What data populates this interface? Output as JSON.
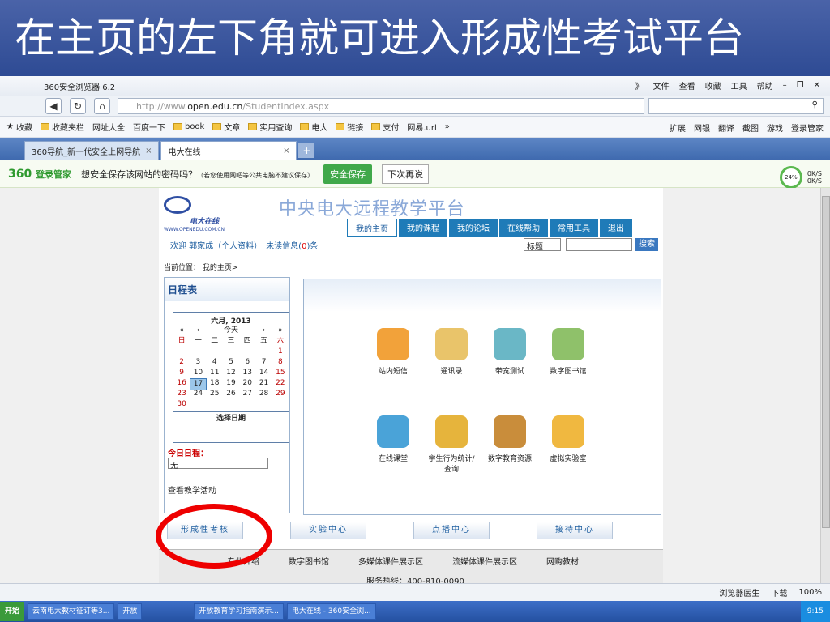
{
  "slide": {
    "title": "在主页的左下角就可进入形成性考试平台"
  },
  "browser": {
    "name": "360安全浏览器 6.2",
    "menu": [
      "》",
      "文件",
      "查看",
      "收藏",
      "工具",
      "帮助"
    ],
    "url_prefix": "http://www.",
    "url_host": "open.edu.cn",
    "url_path": "/StudentIndex.aspx"
  },
  "bookmarks": {
    "items": [
      "收藏",
      "收藏夹栏",
      "网址大全",
      "百度一下",
      "book",
      "文章",
      "实用查询",
      "电大",
      "链接",
      "支付",
      "网易.url",
      "»"
    ],
    "right": [
      "扩展",
      "网银",
      "翻译",
      "截图",
      "游戏",
      "登录管家"
    ]
  },
  "tabs": [
    {
      "label": "360导航_新一代安全上网导航"
    },
    {
      "label": "电大在线"
    }
  ],
  "passbar": {
    "brand": "360",
    "brand2": "登录管家",
    "question": "想安全保存该网站的密码吗？",
    "note": "（若您使用网吧等公共电脑不建议保存）",
    "save": "安全保存",
    "later": "下次再说",
    "pct": "24%",
    "up": "0K/S",
    "down": "0K/S"
  },
  "site": {
    "logo": "电大在线",
    "logo_url": "WWW.OPENEDU.COM.CN",
    "title": "中央电大远程教学平台",
    "nav": [
      "我的主页",
      "我的课程",
      "我的论坛",
      "在线帮助",
      "常用工具",
      "退出"
    ],
    "welcome_pre": "欢迎 郭家成（个人资料）",
    "welcome_unread": "未读信息(",
    "welcome_count": "0",
    "welcome_post": ")条",
    "search_select": "标题",
    "search_btn": "搜索",
    "crumb": "当前位置： 我的主页>",
    "schedule": "日程表",
    "cal": {
      "month": "六月, 2013",
      "nav": [
        "«",
        "‹",
        "今天",
        "›",
        "»"
      ],
      "weekdays": [
        "日",
        "一",
        "二",
        "三",
        "四",
        "五",
        "六"
      ],
      "rows": [
        [
          "",
          "",
          "",
          "",
          "",
          "",
          "1"
        ],
        [
          "2",
          "3",
          "4",
          "5",
          "6",
          "7",
          "8"
        ],
        [
          "9",
          "10",
          "11",
          "12",
          "13",
          "14",
          "15"
        ],
        [
          "16",
          "17",
          "18",
          "19",
          "20",
          "21",
          "22"
        ],
        [
          "23",
          "24",
          "25",
          "26",
          "27",
          "28",
          "29"
        ],
        [
          "30",
          "",
          "",
          "",
          "",
          "",
          ""
        ]
      ],
      "select_date": "选择日期"
    },
    "today_label": "今日日程：",
    "today_value": "无",
    "activities": "查看教学活动",
    "icons": [
      "站内短信",
      "通讯录",
      "带宽测试",
      "数字图书馆",
      "在线课堂",
      "学生行为统计/查询",
      "数字教育资源",
      "虚拟实验室"
    ],
    "bottom_tabs": [
      "形成性考核",
      "实验中心",
      "点播中心",
      "接待中心"
    ],
    "footer_links": [
      "专业介绍",
      "数字图书馆",
      "多媒体课件展示区",
      "流媒体课件展示区",
      "网购教材"
    ],
    "hotline": "服务热线：400-810-0090"
  },
  "statusbar": [
    "浏览器医生",
    "下载",
    "100%"
  ],
  "taskbar": {
    "start": "开始",
    "items": [
      "云南电大教材征订等3...",
      "开放",
      "开放教育学习指南演示...",
      "电大在线 - 360安全浏..."
    ],
    "time": "9:15"
  }
}
